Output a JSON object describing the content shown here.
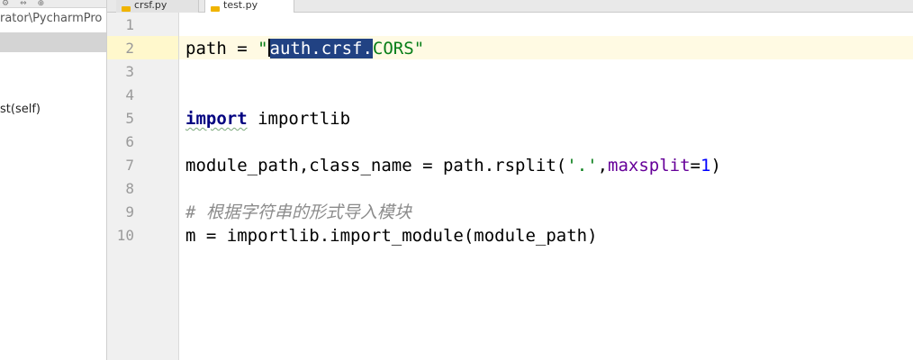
{
  "project_panel": {
    "path_text": "rator\\PycharmPro",
    "tree_item_label": "st(self)"
  },
  "tabs": [
    {
      "label": "crsf.py"
    },
    {
      "label": "test.py"
    }
  ],
  "editor": {
    "line_numbers": [
      "1",
      "2",
      "3",
      "4",
      "5",
      "6",
      "7",
      "8",
      "9",
      "10"
    ],
    "caret_line": 2,
    "line2": {
      "prefix": "path = ",
      "open_quote": "\"",
      "selected": "auth.crsf.",
      "rest": "CORS",
      "close_quote": "\""
    },
    "line5": {
      "keyword": "import",
      "rest": " importlib"
    },
    "line7": {
      "prefix": "module_path,class_name = path.rsplit(",
      "string": "'.'",
      "comma": ",",
      "kwarg": "maxsplit",
      "eq": "=",
      "number": "1",
      "close": ")"
    },
    "line9": {
      "comment": "# 根据字符串的形式导入模块"
    },
    "line10": {
      "text": "m = importlib.import_module(module_path)"
    }
  },
  "colors": {
    "keyword": "#000080",
    "string": "#067d17",
    "kwarg": "#660099",
    "number": "#0000ff",
    "comment": "#8c8c8c",
    "selection": "#214283",
    "caret_line": "#fffae3"
  }
}
